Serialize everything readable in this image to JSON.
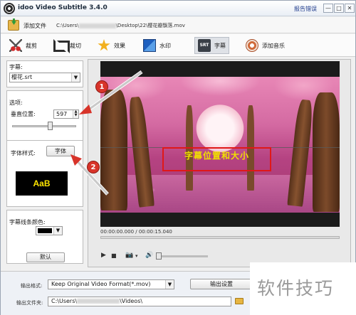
{
  "window": {
    "title": "idoo Video Subtitle 3.4.0",
    "report_link": "报告错误",
    "min": "—",
    "max": "□",
    "close": "✕"
  },
  "add_file": {
    "label": "添加文件",
    "path_prefix": "C:\\Users\\",
    "path_suffix": "\\Desktop\\22\\樱花瓣飘落.mov"
  },
  "toolbar": {
    "items": [
      {
        "label": "裁剪",
        "icon": "scissors-icon"
      },
      {
        "label": "裁切",
        "icon": "crop-icon"
      },
      {
        "label": "效果",
        "icon": "star-icon"
      },
      {
        "label": "水印",
        "icon": "watermark-icon"
      },
      {
        "label": "字幕",
        "icon": "subtitle-icon",
        "active": true
      },
      {
        "label": "添加音乐",
        "icon": "music-icon"
      }
    ]
  },
  "left": {
    "subtitle_label": "字幕:",
    "subtitle_file": "樱花.srt",
    "options_label": "选项:",
    "vertical_label": "垂直位置:",
    "vertical_value": "597",
    "vertical_slider_fraction": 0.6,
    "font_style_label": "字体样式:",
    "font_button": "字体",
    "preview_text": "AaB",
    "border_color_label": "字幕线条颜色:",
    "border_color": "#000000",
    "default_button": "默认"
  },
  "video": {
    "subtitle_text": "字幕位置和大小",
    "timecode": "00:00:00.000 / 00:00:15.040",
    "play": "▶",
    "stop": "■",
    "camera": "📷",
    "camera_dropdown": "▾",
    "volume": "🔊"
  },
  "annotations": {
    "badge1": "1",
    "badge2": "2"
  },
  "bottom": {
    "format_label": "输出格式:",
    "format_value": "Keep Original Video Format(*.mov)",
    "settings_button": "输出设置",
    "folder_label": "输出文件夹:",
    "folder_prefix": "C:\\Users\\",
    "folder_suffix": "\\Videos\\"
  },
  "watermark_brand": "软件技巧",
  "colors": {
    "accent_red": "#d8342a",
    "subtitle_yellow": "#f0e000"
  }
}
